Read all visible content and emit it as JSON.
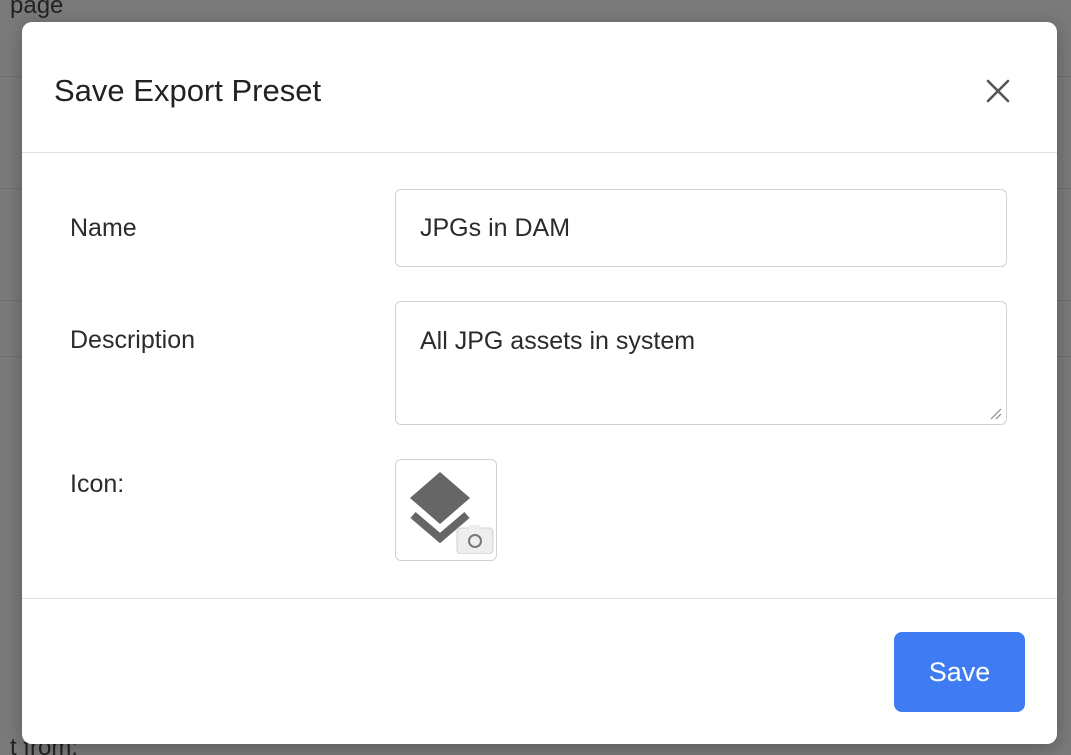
{
  "background": {
    "top_text": "page",
    "bottom_text": "t from:"
  },
  "modal": {
    "title": "Save Export Preset",
    "close_icon": "close-icon",
    "fields": {
      "name": {
        "label": "Name",
        "value": "JPGs in DAM"
      },
      "description": {
        "label": "Description",
        "value": "All JPG assets in system"
      },
      "icon": {
        "label": "Icon:",
        "icon_name": "layers-icon",
        "badge_icon": "camera-icon"
      }
    },
    "save_label": "Save",
    "colors": {
      "primary": "#3f7cf4",
      "icon_gray": "#666666"
    }
  }
}
